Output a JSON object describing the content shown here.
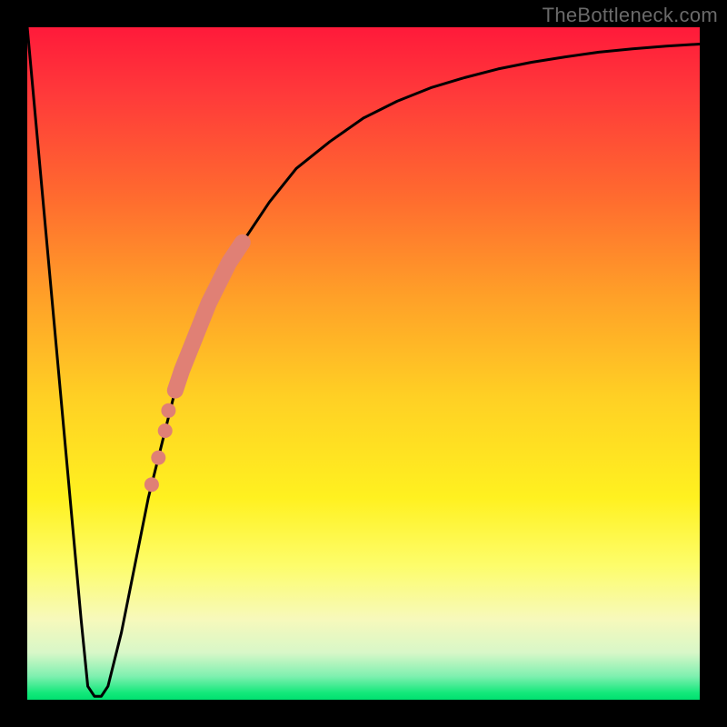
{
  "watermark": "TheBottleneck.com",
  "chart_data": {
    "type": "line",
    "title": "",
    "xlabel": "",
    "ylabel": "",
    "xlim": [
      0,
      100
    ],
    "ylim": [
      0,
      100
    ],
    "grid": false,
    "legend": false,
    "background_gradient": {
      "top": "#ff1a3a",
      "mid": "#fff120",
      "bottom": "#00e070"
    },
    "series": [
      {
        "name": "main-curve",
        "color": "#000000",
        "x": [
          0,
          2,
          4,
          6,
          8,
          9,
          10,
          11,
          12,
          14,
          16,
          18,
          20,
          22,
          25,
          28,
          32,
          36,
          40,
          45,
          50,
          55,
          60,
          65,
          70,
          75,
          80,
          85,
          90,
          95,
          100
        ],
        "y": [
          100,
          78,
          56,
          34,
          12,
          2,
          0.5,
          0.5,
          2,
          10,
          20,
          30,
          38,
          46,
          54,
          61,
          68,
          74,
          79,
          83,
          86.5,
          89,
          91,
          92.5,
          93.8,
          94.8,
          95.6,
          96.3,
          96.8,
          97.2,
          97.5
        ]
      },
      {
        "name": "highlight-segment",
        "color": "#e08075",
        "style": "thick",
        "x": [
          22,
          23,
          24,
          25,
          26,
          27,
          28,
          29,
          30,
          31,
          32
        ],
        "y": [
          46,
          49,
          51.5,
          54,
          56.5,
          59,
          61,
          63,
          65,
          66.5,
          68
        ]
      },
      {
        "name": "highlight-dots",
        "color": "#e08075",
        "style": "dots",
        "x": [
          18.5,
          19.5,
          20.5,
          21.0
        ],
        "y": [
          32,
          36,
          40,
          43
        ]
      }
    ]
  }
}
